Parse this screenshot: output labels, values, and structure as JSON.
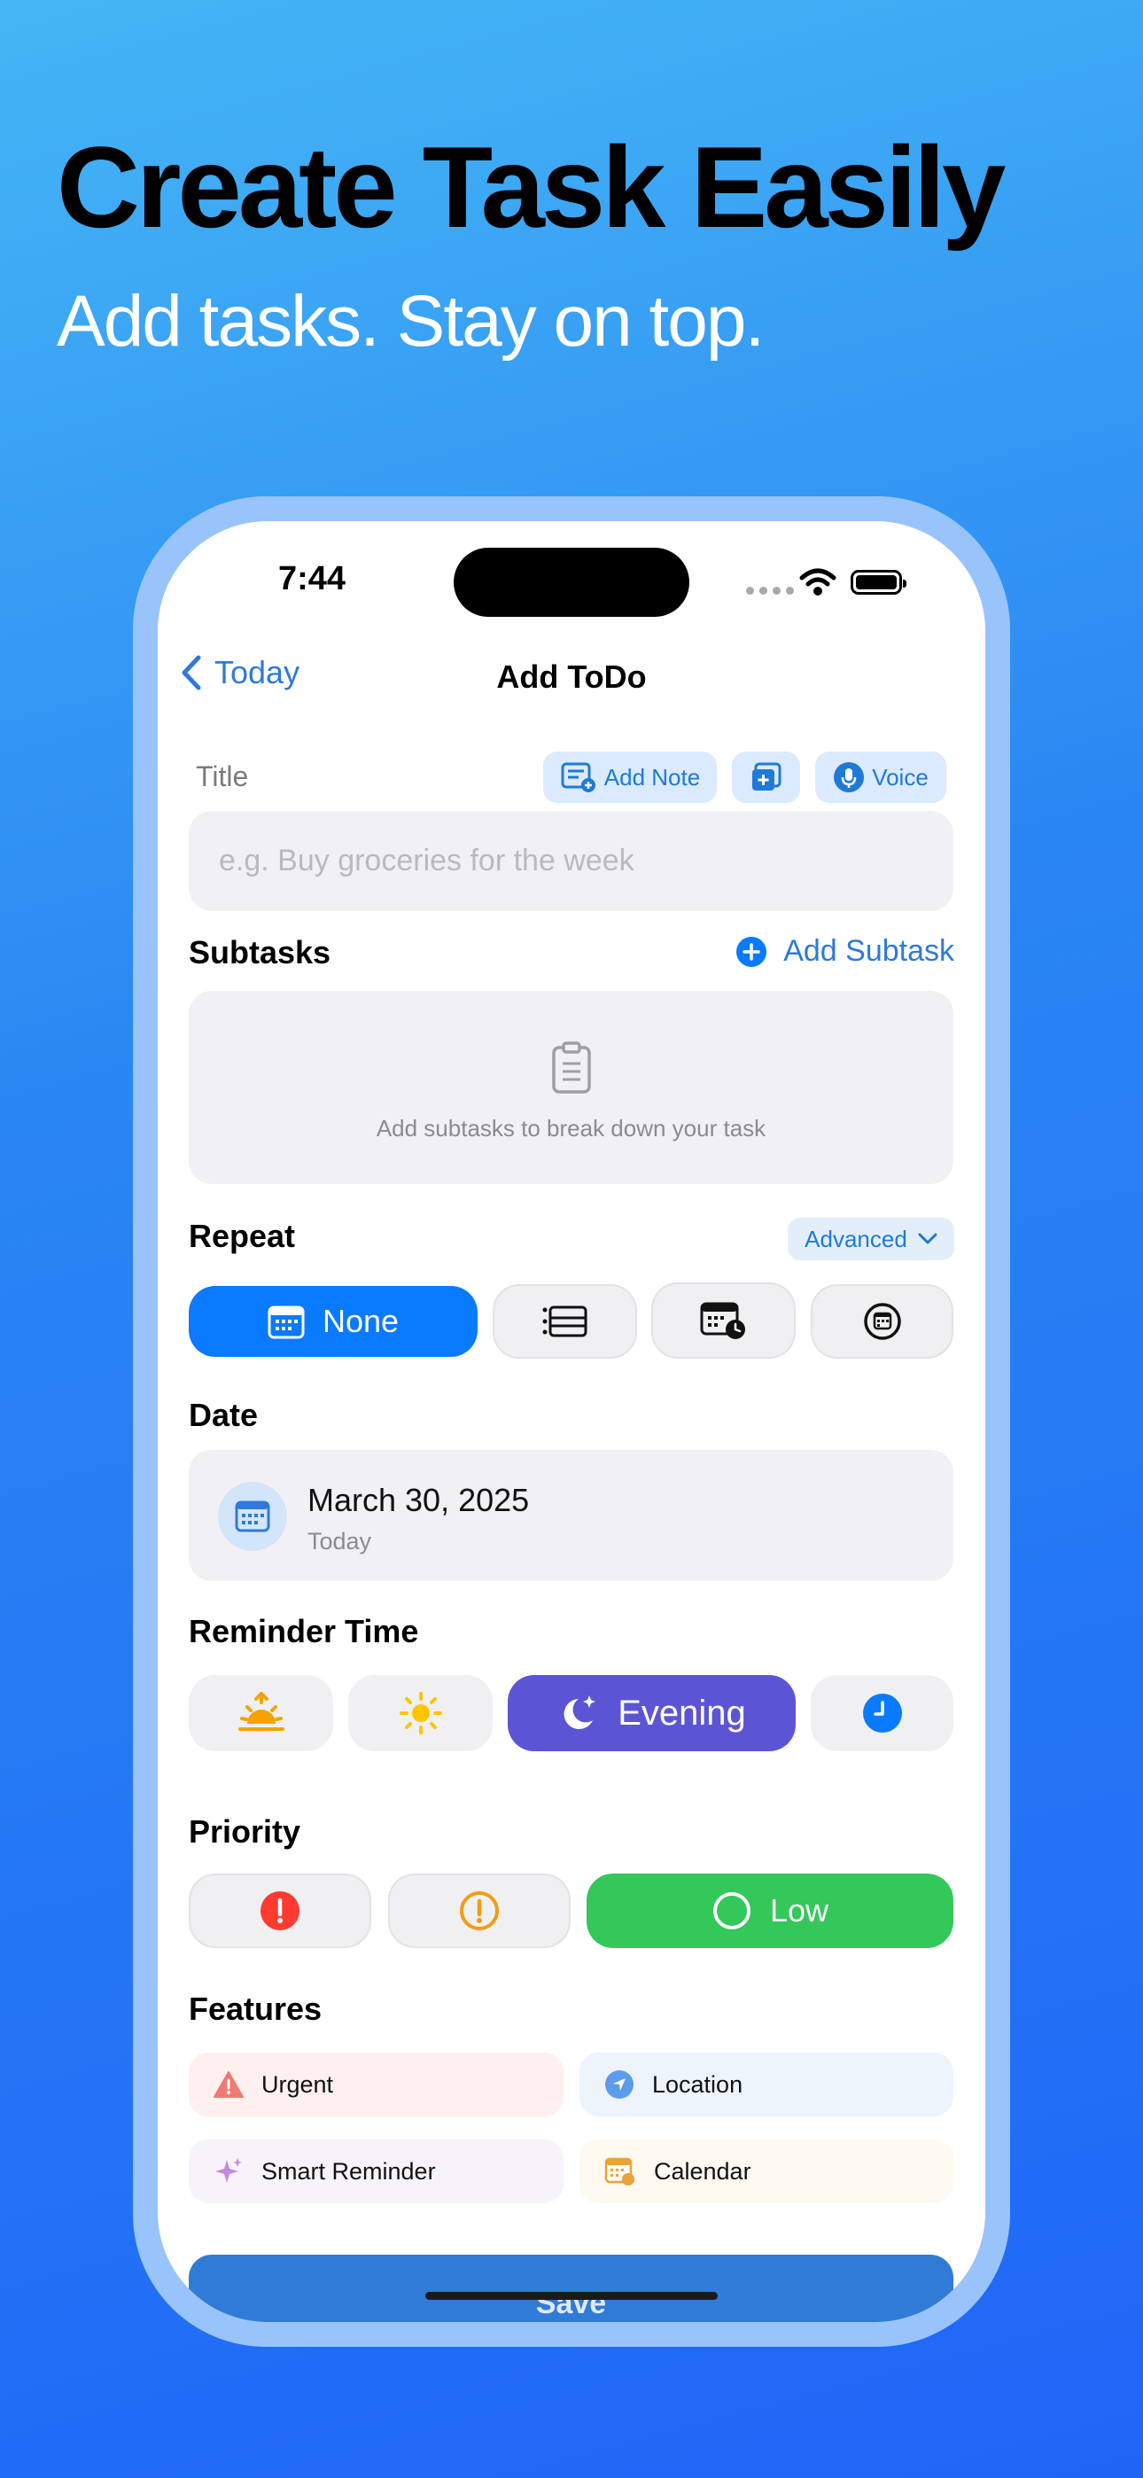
{
  "hero": {
    "title": "Create Task Easily",
    "subtitle": "Add tasks. Stay on top."
  },
  "status_bar": {
    "time": "7:44"
  },
  "nav": {
    "back_label": "Today",
    "title": "Add ToDo"
  },
  "title_field": {
    "label": "Title",
    "placeholder": "e.g. Buy groceries for the week",
    "value": "",
    "add_note_label": "Add Note",
    "voice_label": "Voice"
  },
  "subtasks": {
    "title": "Subtasks",
    "add_label": "Add Subtask",
    "empty_hint": "Add subtasks to break down your task"
  },
  "repeat": {
    "title": "Repeat",
    "advanced_label": "Advanced",
    "selected_label": "None"
  },
  "date": {
    "title": "Date",
    "value": "March 30, 2025",
    "relative": "Today"
  },
  "reminder": {
    "title": "Reminder Time",
    "selected_label": "Evening"
  },
  "priority": {
    "title": "Priority",
    "selected_label": "Low"
  },
  "features": {
    "title": "Features",
    "items": [
      {
        "label": "Urgent"
      },
      {
        "label": "Location"
      },
      {
        "label": "Smart Reminder"
      },
      {
        "label": "Calendar"
      }
    ]
  },
  "save_label": "Save",
  "colors": {
    "accent_blue": "#0a7aff",
    "evening_purple": "#5b55d6",
    "low_green": "#34c759",
    "danger_red": "#ff3b30",
    "warning_orange": "#f39c12"
  }
}
